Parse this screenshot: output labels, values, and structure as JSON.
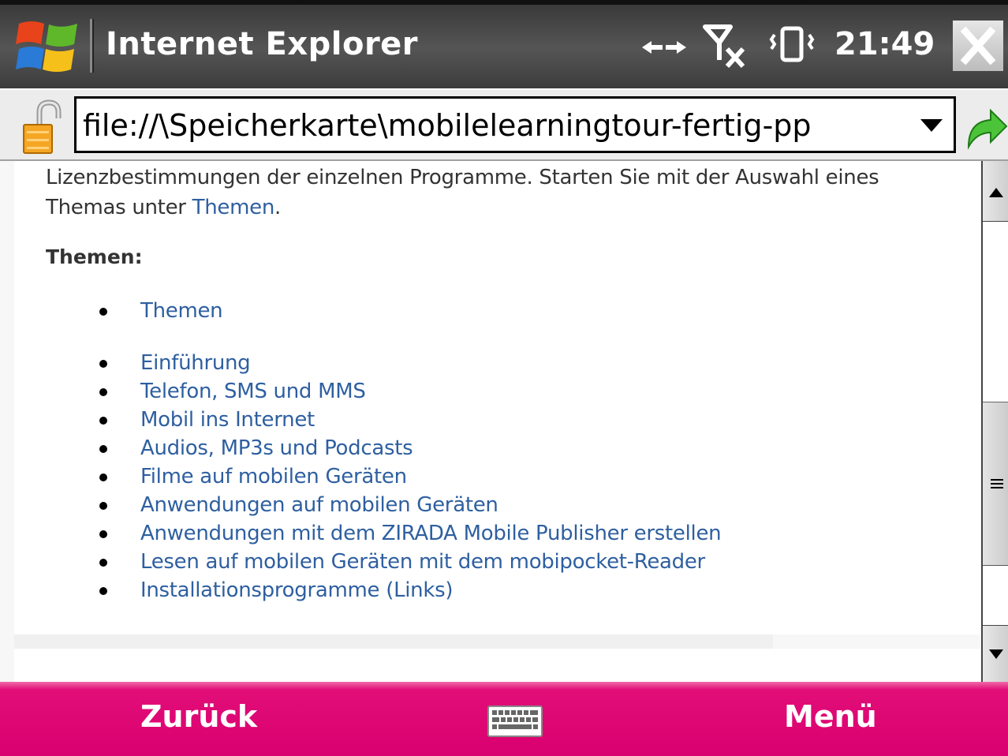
{
  "titlebar": {
    "app_title": "Internet Explorer",
    "clock": "21:49",
    "icons": [
      "windows-start-icon",
      "data-transfer-icon",
      "no-signal-icon",
      "vibrate-icon",
      "close-icon"
    ]
  },
  "address_bar": {
    "url": "file://\\Speicherkarte\\mobilelearningtour-fertig-pp",
    "icons": [
      "unlocked-padlock-icon",
      "dropdown-arrow-icon",
      "go-arrow-icon"
    ]
  },
  "content": {
    "intro_text": "Lizenzbestimmungen der einzelnen Programme. Starten Sie mit der Auswahl eines Themas unter",
    "intro_link": "Themen",
    "intro_end": ".",
    "section_heading": "Themen:",
    "first_topic": "Themen",
    "topics": [
      "Einführung",
      "Telefon, SMS und MMS",
      "Mobil ins Internet",
      "Audios, MP3s und Podcasts",
      "Filme auf mobilen Geräten",
      "Anwendungen auf mobilen Geräten",
      "Anwendungen mit dem ZIRADA Mobile Publisher erstellen",
      "Lesen auf mobilen Geräten mit dem mobipocket-Reader",
      "Installationsprogramme (Links)"
    ]
  },
  "softkeys": {
    "left": "Zurück",
    "right": "Menü",
    "center_icon": "keyboard-icon"
  },
  "colors": {
    "link": "#2e5fa0",
    "softkey_bar": "#d9006f",
    "titlebar": "#4a4a4a"
  }
}
